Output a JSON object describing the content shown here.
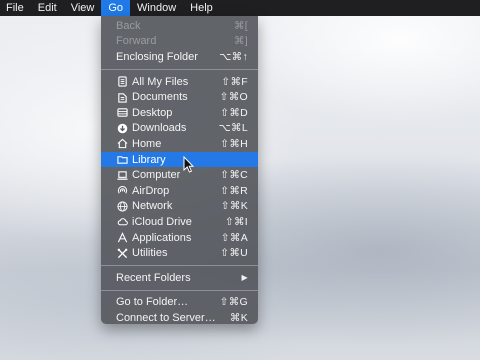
{
  "menubar": {
    "items": [
      {
        "label": "File"
      },
      {
        "label": "Edit"
      },
      {
        "label": "View"
      },
      {
        "label": "Go"
      },
      {
        "label": "Window"
      },
      {
        "label": "Help"
      }
    ],
    "active_index": 3
  },
  "go_menu": {
    "history": [
      {
        "label": "Back",
        "shortcut": "⌘[",
        "enabled": false
      },
      {
        "label": "Forward",
        "shortcut": "⌘]",
        "enabled": false
      },
      {
        "label": "Enclosing Folder",
        "shortcut": "⌥⌘↑",
        "enabled": true
      }
    ],
    "places": [
      {
        "label": "All My Files",
        "shortcut": "⇧⌘F",
        "icon": "all-files-icon"
      },
      {
        "label": "Documents",
        "shortcut": "⇧⌘O",
        "icon": "documents-icon"
      },
      {
        "label": "Desktop",
        "shortcut": "⇧⌘D",
        "icon": "desktop-icon"
      },
      {
        "label": "Downloads",
        "shortcut": "⌥⌘L",
        "icon": "downloads-icon"
      },
      {
        "label": "Home",
        "shortcut": "⇧⌘H",
        "icon": "home-icon"
      },
      {
        "label": "Library",
        "shortcut": "",
        "icon": "folder-icon",
        "highlighted": true
      },
      {
        "label": "Computer",
        "shortcut": "⇧⌘C",
        "icon": "computer-icon"
      },
      {
        "label": "AirDrop",
        "shortcut": "⇧⌘R",
        "icon": "airdrop-icon"
      },
      {
        "label": "Network",
        "shortcut": "⇧⌘K",
        "icon": "network-icon"
      },
      {
        "label": "iCloud Drive",
        "shortcut": "⇧⌘I",
        "icon": "icloud-icon"
      },
      {
        "label": "Applications",
        "shortcut": "⇧⌘A",
        "icon": "applications-icon"
      },
      {
        "label": "Utilities",
        "shortcut": "⇧⌘U",
        "icon": "utilities-icon"
      }
    ],
    "recent": {
      "label": "Recent Folders",
      "submenu_arrow": "▶"
    },
    "goto": [
      {
        "label": "Go to Folder…",
        "shortcut": "⇧⌘G"
      },
      {
        "label": "Connect to Server…",
        "shortcut": "⌘K"
      }
    ]
  },
  "colors": {
    "menubar_bg": "#1f1f21",
    "menu_bg": "#56595f",
    "highlight": "#2479e6",
    "disabled_text": "#9a9ca0"
  }
}
